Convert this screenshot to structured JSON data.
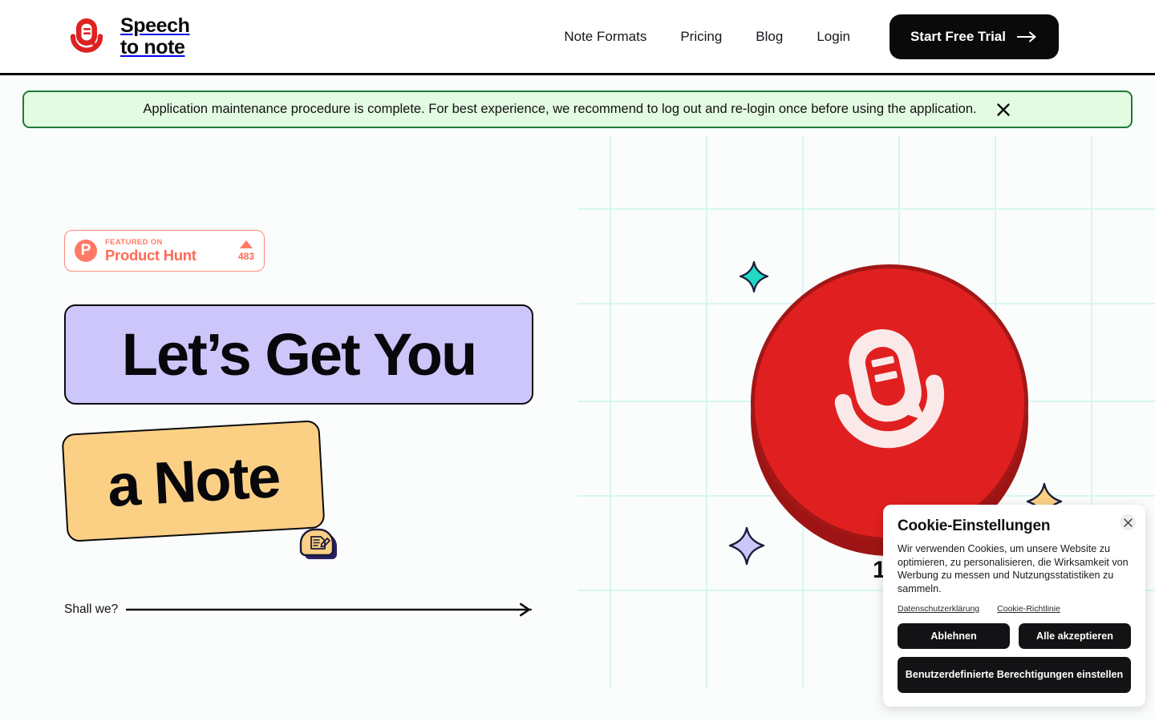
{
  "header": {
    "logo": {
      "icon": "speech-to-note-logo-icon",
      "line1": "Speech",
      "line2": "to note"
    },
    "nav": [
      {
        "label": "Note Formats"
      },
      {
        "label": "Pricing"
      },
      {
        "label": "Blog"
      },
      {
        "label": "Login"
      }
    ],
    "cta": {
      "label": "Start Free Trial",
      "icon": "arrow-right-icon"
    }
  },
  "banner": {
    "message": "Application maintenance procedure is complete. For best experience, we recommend to log out and re-login once before using the application.",
    "close_icon": "close-icon",
    "background": "#e3fae3",
    "border_color": "#1f7a37"
  },
  "hero": {
    "product_hunt": {
      "badge_letter": "P",
      "featured_label": "FEATURED ON",
      "name": "Product Hunt",
      "upvote_icon": "triangle-up-icon",
      "votes": "483",
      "accent": "#ff7a66"
    },
    "headline_line1": "Let’s Get You",
    "headline_line2": "a Note",
    "line1_bg": "#ccc6fa",
    "line2_bg": "#fbd085",
    "sticker_icon": "note-and-pen-sticker-icon",
    "cta_text": "Shall we?",
    "cta_arrow_icon": "long-arrow-right-icon",
    "art": {
      "disc_color": "#e02020",
      "disc_shadow_color": "#9e1414",
      "logo_icon": "speech-to-note-mark-icon",
      "grid_color": "#d7f6f1",
      "stars": [
        {
          "name": "sparkle-star-teal",
          "color": "#21d9c4"
        },
        {
          "name": "sparkle-star-purple",
          "color": "#ccc6fa"
        },
        {
          "name": "sparkle-star-yellow",
          "color": "#fbd085"
        }
      ],
      "partial_number": "1"
    }
  },
  "cookie_dialog": {
    "title": "Cookie-Einstellungen",
    "body": "Wir verwenden Cookies, um unsere Website zu optimieren, zu personalisieren, die Wirksamkeit von Werbung zu messen und Nutzungsstatistiken zu sammeln.",
    "links": [
      {
        "label": "Datenschutzerklärung"
      },
      {
        "label": "Cookie-Richtlinie"
      }
    ],
    "buttons": {
      "decline": "Ablehnen",
      "accept_all": "Alle akzeptieren",
      "custom": "Benutzerdefinierte Berechtigungen einstellen"
    },
    "close_icon": "close-icon"
  }
}
